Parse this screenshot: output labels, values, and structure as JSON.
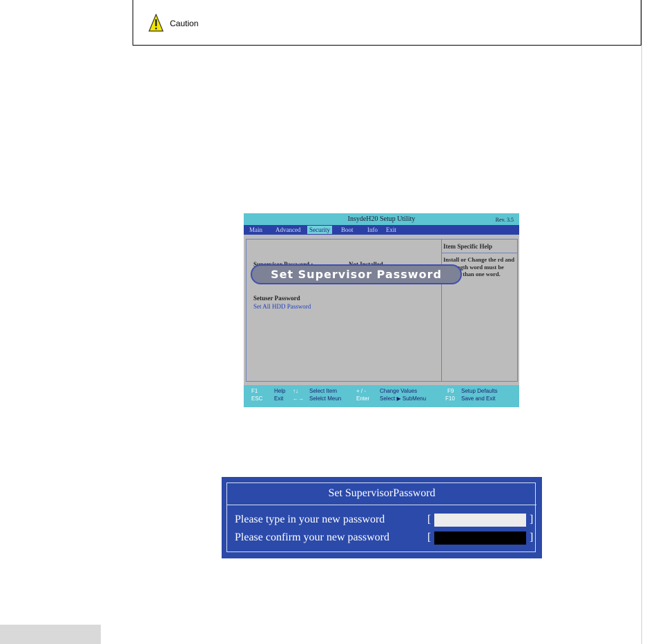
{
  "caution": {
    "label": "Caution"
  },
  "bios": {
    "title": "InsydeH20 Setup Utility",
    "rev": "Rev. 3.5",
    "menu": [
      "Main",
      "Advanced",
      "Security",
      "Boot",
      "Info",
      "Exit"
    ],
    "active_menu": "Security",
    "security": {
      "supervisor_label": "Supervisor Password  :",
      "supervisor_value": "Not Installed",
      "setuser": "Setuser Password",
      "set_all_hdd": "Set All HDD Password"
    },
    "help": {
      "title": "Item Specific Help",
      "text": "Install or Change the rd and the length word must be greater than one word."
    },
    "footer": {
      "f1": "F1",
      "help": "Help",
      "updown": "↑↓",
      "select_item": "Select Item",
      "plusminus": "+ / -",
      "change_values": "Change Values",
      "f9": "F9",
      "setup_defaults": "Setup Defaults",
      "esc": "ESC",
      "exit": "Exit",
      "leftright": "←→",
      "select_menu": "Selelct Meun",
      "enter": "Enter",
      "select_submenu": "Select ▶ SubMenu",
      "f10": "F10",
      "save_exit": "Save and Exit"
    }
  },
  "callout": {
    "text": "Set Supervisor Password"
  },
  "dialog": {
    "title": "Set SupervisorPassword",
    "line1": "Please type in your new password",
    "line2": "Please confirm your new password",
    "bracket_open": "[",
    "bracket_close": "]",
    "password_value": "",
    "confirm_value": ""
  },
  "colors": {
    "bios_cyan": "#5dc4d2",
    "bios_blue": "#2b40a6",
    "dialog_blue": "#2b4aaa",
    "caution_yellow": "#f2e600"
  }
}
